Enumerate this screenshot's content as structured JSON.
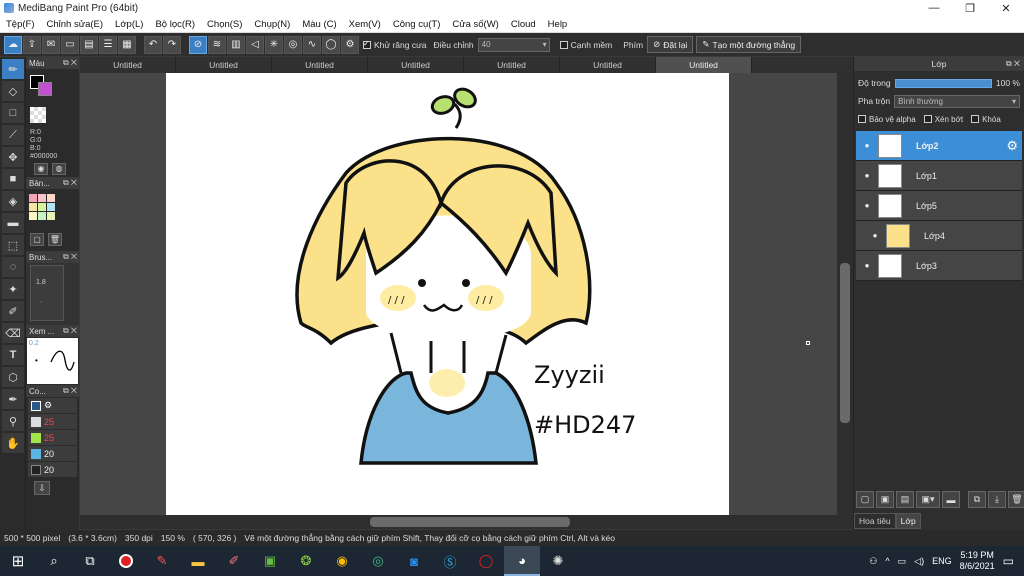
{
  "app": {
    "title": "MediBang Paint Pro (64bit)",
    "window_buttons": [
      "—",
      "❐",
      "✕"
    ]
  },
  "menu": [
    "Tệp(F)",
    "Chỉnh sửa(E)",
    "Lớp(L)",
    "Bộ lọc(R)",
    "Chọn(S)",
    "Chụp(N)",
    "Màu (C)",
    "Xem(V)",
    "Công cụ(T)",
    "Cửa số(W)",
    "Cloud",
    "Help"
  ],
  "toolbar": {
    "antialias_label": "Khử răng cưa",
    "adjust_label": "Điều chỉnh",
    "adjust_value": "40",
    "smooth_label": "Cạnh mềm",
    "key_label": "Phím",
    "reset_label": "Đặt lại",
    "straight_line_label": "Tạo một đường thẳng"
  },
  "left_panels": {
    "color_title": "Màu",
    "rgb": [
      "R:0",
      "G:0",
      "B:0"
    ],
    "hex": "#000000",
    "palette_title": "Bản...",
    "brush_title": "Brus...",
    "brush_size": "1.8",
    "preview_title": "Xem ...",
    "preview_value": "0.2",
    "colorset_title": "Co...",
    "colorset_rows": [
      "",
      "25",
      "25",
      "20",
      "20"
    ]
  },
  "tabs": [
    "Untitled",
    "Untitled",
    "Untitled",
    "Untitled",
    "Untitled",
    "Untitled",
    "Untitled"
  ],
  "artwork": {
    "signature_line1": "Zyyzii",
    "signature_line2": "#HD247"
  },
  "layers_panel": {
    "title": "Lớp",
    "opacity_label": "Độ trong",
    "opacity_value": "100 %",
    "opacity": 1.0,
    "blend_label": "Pha trộn",
    "blend_value": "Bình thường",
    "protect_alpha": "Bảo vệ alpha",
    "clipping": "Xén bớt",
    "lock": "Khóa",
    "layers": [
      {
        "name": "Lớp2",
        "selected": true
      },
      {
        "name": "Lớp1",
        "selected": false
      },
      {
        "name": "Lớp5",
        "selected": false
      },
      {
        "name": "Lớp4",
        "selected": false
      },
      {
        "name": "Lớp3",
        "selected": false
      }
    ],
    "bottom_tabs": [
      "Hoa tiêu",
      "Lớp"
    ]
  },
  "status": {
    "size": "500 * 500 pixel",
    "cm": "(3.6 * 3.6cm)",
    "dpi": "350 dpi",
    "zoom": "150 %",
    "coords": "( 570, 326 )",
    "hint": "Vẽ một đường thẳng bằng cách giữ phím Shift, Thay đổi cỡ cọ bằng cách giữ phím Ctrl, Alt và kéo"
  },
  "taskbar": {
    "lang": "ENG",
    "time": "5:19 PM",
    "date": "8/6/2021"
  }
}
